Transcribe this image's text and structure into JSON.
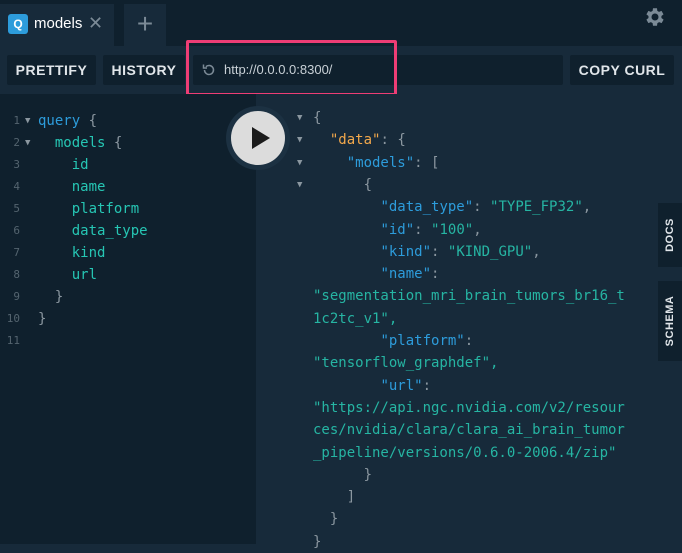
{
  "tabs": [
    {
      "badge": "Q",
      "title": "models",
      "close": "✕"
    }
  ],
  "add_tab": "+",
  "toolbar": {
    "prettify": "PRETTIFY",
    "history": "HISTORY",
    "url": "http://0.0.0.0:8300/",
    "copy_curl": "COPY CURL"
  },
  "side_tabs": {
    "docs": "DOCS",
    "schema": "SCHEMA"
  },
  "query_lines": [
    {
      "n": "1",
      "t": "query {"
    },
    {
      "n": "2",
      "t": "  models {"
    },
    {
      "n": "3",
      "t": "    id"
    },
    {
      "n": "4",
      "t": "    name"
    },
    {
      "n": "5",
      "t": "    platform"
    },
    {
      "n": "6",
      "t": "    data_type"
    },
    {
      "n": "7",
      "t": "    kind"
    },
    {
      "n": "8",
      "t": "    url"
    },
    {
      "n": "9",
      "t": "  }"
    },
    {
      "n": "10",
      "t": "}"
    },
    {
      "n": "11",
      "t": ""
    }
  ],
  "result_lines": [
    "{",
    "  \"data\": {",
    "    \"models\": [",
    "      {",
    "        \"data_type\": \"TYPE_FP32\",",
    "        \"id\": \"100\",",
    "        \"kind\": \"KIND_GPU\",",
    "        \"name\":",
    "\"segmentation_mri_brain_tumors_br16_t",
    "1c2tc_v1\",",
    "        \"platform\":",
    "\"tensorflow_graphdef\",",
    "        \"url\":",
    "\"https://api.ngc.nvidia.com/v2/resour",
    "ces/nvidia/clara/clara_ai_brain_tumor",
    "_pipeline/versions/0.6.0-2006.4/zip\"",
    "      }",
    "    ]",
    "  }",
    "}"
  ],
  "colors": {
    "highlight": "#ee3d75",
    "accent": "#2d9cdb",
    "field": "#26c6b4",
    "data_key": "#f2a84b"
  },
  "icons": [
    "settings-gear-icon",
    "reload-icon",
    "play-icon",
    "close-icon",
    "add-icon"
  ]
}
